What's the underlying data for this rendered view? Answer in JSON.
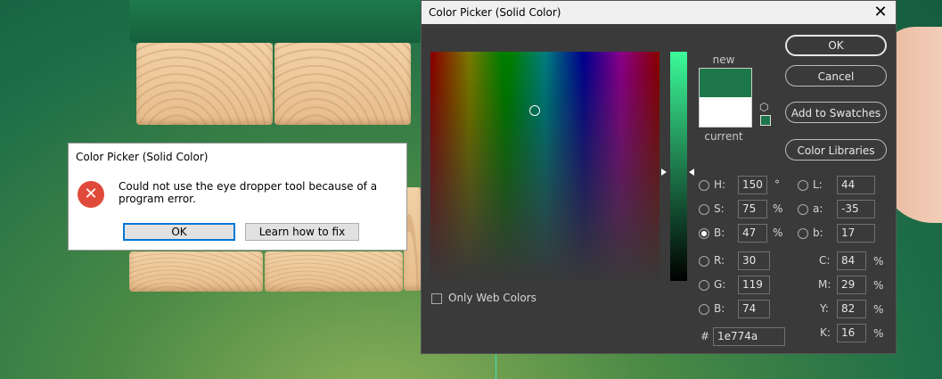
{
  "color_picker": {
    "title": "Color Picker (Solid Color)",
    "close_glyph": "✕",
    "buttons": {
      "ok": "OK",
      "cancel": "Cancel",
      "add_to_swatches": "Add to Swatches",
      "color_libraries": "Color Libraries"
    },
    "swatch": {
      "new_label": "new",
      "current_label": "current",
      "new_color": "#1e774a",
      "current_color": "#ffffff"
    },
    "only_web_colors": "Only Web Colors",
    "hsb": {
      "h": "150",
      "s": "75",
      "b": "47",
      "h_unit": "°",
      "s_unit": "%",
      "b_unit": "%",
      "h_label": "H:",
      "s_label": "S:",
      "b_label": "B:"
    },
    "rgb": {
      "r": "30",
      "g": "119",
      "b": "74",
      "r_label": "R:",
      "g_label": "G:",
      "b_label": "B:"
    },
    "lab": {
      "l": "44",
      "a": "-35",
      "b": "17",
      "l_label": "L:",
      "a_label": "a:",
      "b_label": "b:"
    },
    "cmyk": {
      "c": "84",
      "m": "29",
      "y": "82",
      "k": "16",
      "c_label": "C:",
      "m_label": "M:",
      "y_label": "Y:",
      "k_label": "K:",
      "unit": "%"
    },
    "hex_label": "#",
    "hex": "1e774a",
    "selected_mode": "B"
  },
  "error_dialog": {
    "title": "Color Picker (Solid Color)",
    "message": "Could not use the eye dropper tool because of a program error.",
    "ok": "OK",
    "learn": "Learn how to fix",
    "icon": "error-icon"
  }
}
